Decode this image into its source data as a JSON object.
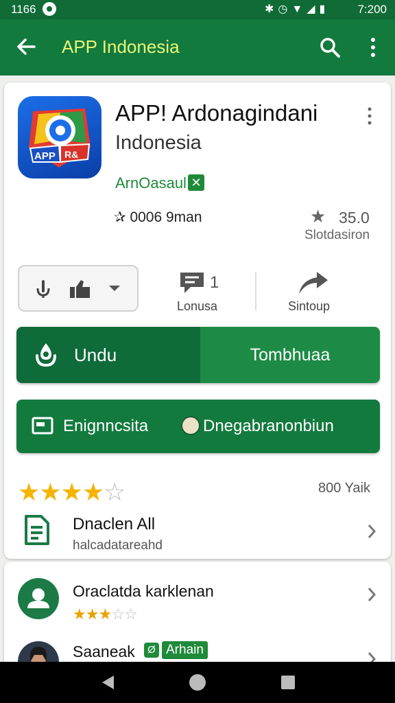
{
  "status_bar": {
    "left_time": "1166",
    "clock": "7:200",
    "icons": [
      "notification-icon",
      "bluetooth-icon",
      "alarm-icon",
      "wifi-icon",
      "signal-icon",
      "battery-icon"
    ]
  },
  "app_bar": {
    "title": "APP Indonesia"
  },
  "app": {
    "name": "APP! Ardonagindani",
    "subtitle": "Indonesia",
    "developer": "ArnOasaul",
    "verified_glyph": "✕",
    "downloads": "0006 9man",
    "rating_value": "35.0",
    "rating_label": "Slotdasiron",
    "icon_badge_text_1": "APP",
    "icon_badge_text_2": "R&"
  },
  "stats": {
    "comments_count": "1",
    "comments_label": "Lonusa",
    "share_label": "Sintoup"
  },
  "buttons": {
    "download_label": "Undu",
    "install_label": "Tombhuaa",
    "secondary_left_label": "Enignncsita",
    "secondary_right_label": "Dnegabranonbiun"
  },
  "rating_row": {
    "stars_filled": 3.5,
    "stars_total": 5,
    "count_label": "800 Yaik"
  },
  "detail_row": {
    "title": "Dnaclen All",
    "subtitle": "halcadatareahd"
  },
  "reviews": [
    {
      "title": "Oraclatda karklenan",
      "stars_filled": 3,
      "stars_total": 5
    },
    {
      "title": "Saaneak",
      "badge_glyph": "Ø",
      "badge_text": "Arhain"
    }
  ],
  "colors": {
    "primary": "#137a3e",
    "primary_dark": "#0f6b3a",
    "accent_title": "#e8f57a",
    "star": "#f4b400"
  }
}
